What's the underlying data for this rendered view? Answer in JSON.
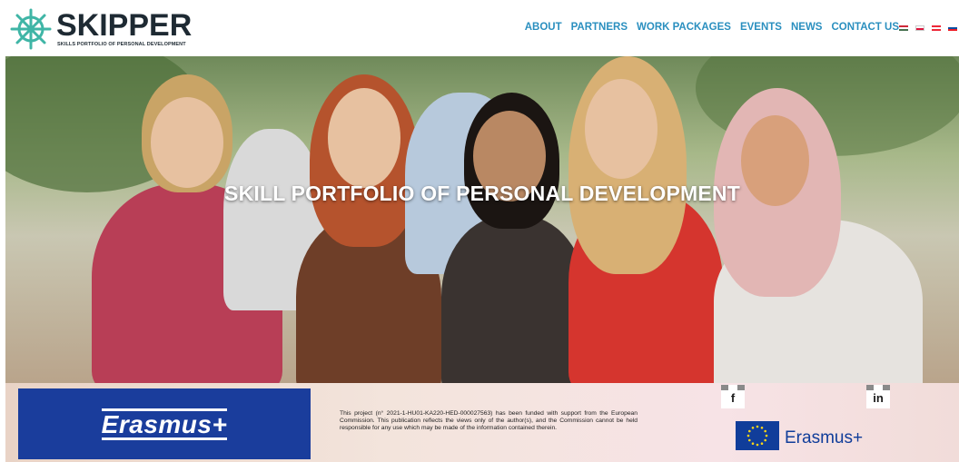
{
  "header": {
    "logo_title": "SKIPPER",
    "logo_subtitle": "SKILLS PORTFOLIO OF PERSONAL DEVELOPMENT",
    "nav": [
      "ABOUT",
      "PARTNERS",
      "WORK PACKAGES",
      "EVENTS",
      "NEWS",
      "CONTACT US"
    ],
    "flags": [
      "hungary-flag-icon",
      "poland-flag-icon",
      "austria-flag-icon",
      "slovakia-flag-icon"
    ]
  },
  "hero": {
    "title": "SKILL PORTFOLIO OF PERSONAL DEVELOPMENT"
  },
  "footer": {
    "erasmus_banner_text": "Erasmus+",
    "disclaimer": "This project (n° 2021-1-HU01-KA220-HED-000027563) has been funded with support from the European Commission. This publication reflects the views only of the author(s), and the Commission cannot be held responsible for any use which may be made of the information contained therein.",
    "facebook_label": "f",
    "linkedin_label": "in",
    "eu_text": "Erasmus+"
  },
  "colors": {
    "nav": "#2a8fbf",
    "erasmus_blue": "#1a3d9c",
    "logo": "#1e2a33"
  }
}
